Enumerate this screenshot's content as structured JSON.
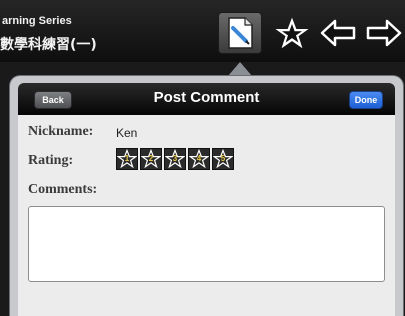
{
  "header": {
    "series_title": "arning Series",
    "series_subtitle": "數學科練習(一)"
  },
  "toolbar": {
    "buttons": [
      {
        "icon": "note-icon",
        "active": true
      },
      {
        "icon": "star-icon",
        "active": false
      },
      {
        "icon": "arrow-left-icon",
        "active": false
      },
      {
        "icon": "arrow-right-icon",
        "active": false
      }
    ]
  },
  "dialog": {
    "title": "Post Comment",
    "back_label": "Back",
    "done_label": "Done",
    "nickname_label": "Nickname:",
    "nickname_value": "Ken",
    "rating_label": "Rating:",
    "rating_stars": [
      "1",
      "2",
      "3",
      "4",
      "5"
    ],
    "comments_label": "Comments:",
    "comments_value": ""
  },
  "colors": {
    "done_button": "#1d5fd4",
    "star_number": "#e9c84a"
  }
}
